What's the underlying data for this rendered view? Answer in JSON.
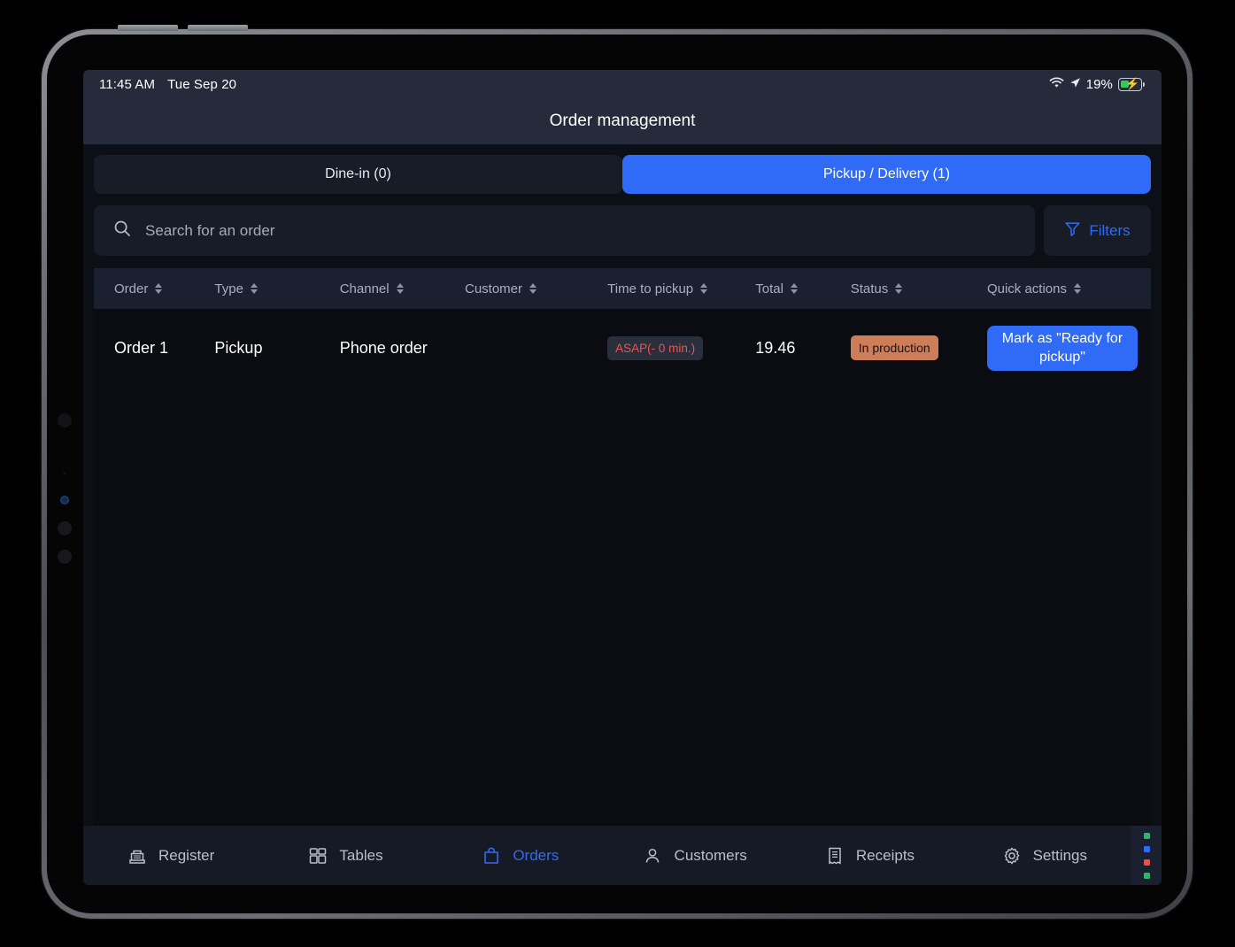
{
  "status_bar": {
    "time": "11:45 AM",
    "date": "Tue Sep 20",
    "battery_percent": "19%",
    "wifi_icon": "wifi-icon",
    "location_icon": "location-arrow-icon",
    "battery_icon": "battery-charging-icon"
  },
  "header": {
    "title": "Order management"
  },
  "tabs": [
    {
      "label": "Dine-in (0)",
      "active": false
    },
    {
      "label": "Pickup / Delivery (1)",
      "active": true
    }
  ],
  "search": {
    "placeholder": "Search for an order",
    "value": "",
    "icon": "search-icon"
  },
  "filters": {
    "label": "Filters",
    "icon": "filter-funnel-icon"
  },
  "table": {
    "columns": [
      "Order",
      "Type",
      "Channel",
      "Customer",
      "Time to pickup",
      "Total",
      "Status",
      "Quick actions"
    ],
    "rows": [
      {
        "order": "Order 1",
        "type": "Pickup",
        "channel": "Phone order",
        "customer": "",
        "time_to_pickup": "ASAP(- 0 min.)",
        "total": "19.46",
        "status": "In production",
        "action": "Mark as \"Ready for pickup\""
      }
    ]
  },
  "bottom_nav": [
    {
      "label": "Register",
      "icon": "cash-register-icon",
      "active": false
    },
    {
      "label": "Tables",
      "icon": "grid-tables-icon",
      "active": false
    },
    {
      "label": "Orders",
      "icon": "shopping-bag-icon",
      "active": true
    },
    {
      "label": "Customers",
      "icon": "person-icon",
      "active": false
    },
    {
      "label": "Receipts",
      "icon": "receipt-icon",
      "active": false
    },
    {
      "label": "Settings",
      "icon": "gear-icon",
      "active": false
    }
  ],
  "status_dots": [
    "#34b26a",
    "#2f6bf6",
    "#e2524f",
    "#34b26a"
  ],
  "colors": {
    "accent_blue": "#2f6bf6",
    "status_badge": "#cd7d57",
    "asap_red": "#f0534e",
    "screen_bg": "#0d0f16",
    "panel_bg": "#181c27",
    "header_bar": "#252b3b"
  }
}
